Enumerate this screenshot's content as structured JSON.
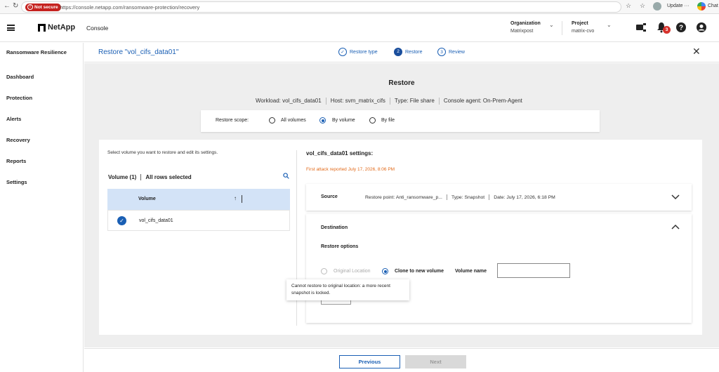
{
  "browser": {
    "security_label": "Not secure",
    "url": "https://console.netapp.com/ransomware-protection/recovery",
    "update_label": "Update ···",
    "chat_label": "Chat"
  },
  "header": {
    "logo": "NetApp",
    "app_name": "Console",
    "org_label": "Organization",
    "org_value": "Matrixpost",
    "project_label": "Project",
    "project_value": "matrix-cvo",
    "notification_count": "3"
  },
  "sidebar": {
    "title": "Ransomware Resilience",
    "items": [
      {
        "label": "Dashboard"
      },
      {
        "label": "Protection"
      },
      {
        "label": "Alerts"
      },
      {
        "label": "Recovery"
      },
      {
        "label": "Reports"
      },
      {
        "label": "Settings"
      }
    ]
  },
  "page": {
    "title": "Restore \"vol_cifs_data01\"",
    "steps": [
      {
        "num": "✓",
        "label": "Restore type",
        "state": "done"
      },
      {
        "num": "2",
        "label": "Restore",
        "state": "active"
      },
      {
        "num": "3",
        "label": "Review",
        "state": "future"
      }
    ]
  },
  "restore": {
    "heading": "Restore",
    "workload": "Workload: vol_cifs_data01",
    "host": "Host: svm_matrix_cifs",
    "type": "Type: File share",
    "agent": "Console agent: On-Prem-Agent",
    "scope_label": "Restore scope:",
    "scope_options": [
      {
        "label": "All volumes",
        "checked": false
      },
      {
        "label": "By volume",
        "checked": true
      },
      {
        "label": "By file",
        "checked": false
      }
    ]
  },
  "volumes": {
    "instruction": "Select volume you want to restore and edit its settings.",
    "count_label": "Volume (1)",
    "selection_label": "All rows selected",
    "column_header": "Volume",
    "sort_icon": "↑",
    "rows": [
      {
        "name": "vol_cifs_data01",
        "selected": true
      }
    ]
  },
  "settings": {
    "title": "vol_cifs_data01 settings:",
    "attack_notice": "First attack reported July 17, 2026, 8:06 PM",
    "source_label": "Source",
    "restore_point": "Restore point: Anti_ransomware_p...",
    "source_type": "Type: Snapshot",
    "source_date": "Date: July 17, 2026, 6:18 PM",
    "destination_label": "Destination",
    "restore_options_label": "Restore options",
    "original_location": "Original Location",
    "clone_option": "Clone to new volume",
    "volume_name_label": "Volume name",
    "volume_name_value": ""
  },
  "tooltip": {
    "text": "Cannot restore to original location: a more recent snapshot is locked."
  },
  "footer": {
    "previous": "Previous",
    "next": "Next"
  },
  "colors": {
    "accent": "#1a5fb4",
    "attack": "#e26a1a",
    "badge": "#d6322c"
  }
}
